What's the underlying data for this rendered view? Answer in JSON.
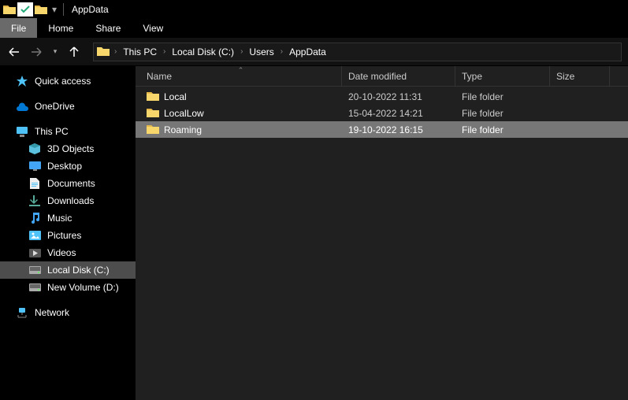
{
  "titlebar": {
    "title": "AppData"
  },
  "ribbon": {
    "file": "File",
    "home": "Home",
    "share": "Share",
    "view": "View"
  },
  "breadcrumb": {
    "items": [
      "This PC",
      "Local Disk (C:)",
      "Users",
      "AppData"
    ]
  },
  "sidebar": {
    "quick_access": "Quick access",
    "onedrive": "OneDrive",
    "this_pc": "This PC",
    "objects3d": "3D Objects",
    "desktop": "Desktop",
    "documents": "Documents",
    "downloads": "Downloads",
    "music": "Music",
    "pictures": "Pictures",
    "videos": "Videos",
    "local_disk": "Local Disk (C:)",
    "new_volume": "New Volume (D:)",
    "network": "Network"
  },
  "columns": {
    "name": "Name",
    "date": "Date modified",
    "type": "Type",
    "size": "Size"
  },
  "files": [
    {
      "name": "Local",
      "date": "20-10-2022 11:31",
      "type": "File folder",
      "size": "",
      "selected": false
    },
    {
      "name": "LocalLow",
      "date": "15-04-2022 14:21",
      "type": "File folder",
      "size": "",
      "selected": false
    },
    {
      "name": "Roaming",
      "date": "19-10-2022 16:15",
      "type": "File folder",
      "size": "",
      "selected": true
    }
  ]
}
